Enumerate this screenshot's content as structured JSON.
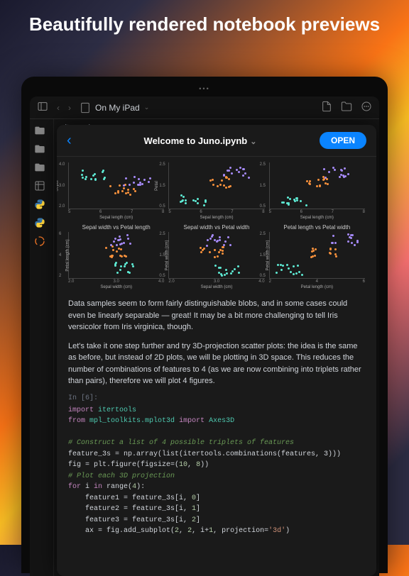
{
  "hero": {
    "title": "Beautifully rendered notebook previews"
  },
  "toolbar": {
    "breadcrumb": "On My iPad"
  },
  "sidebar": {
    "bg_label": "site-packages"
  },
  "modal": {
    "title": "Welcome to Juno.ipynb",
    "open_label": "OPEN"
  },
  "charts": {
    "row1": [
      {
        "title": "",
        "xlabel": "Sepal length (cm)",
        "ylabel": "Sepal",
        "xticks": [
          "5",
          "6",
          "7",
          "8"
        ],
        "yticks": [
          "2.0",
          "3.0",
          "4.0"
        ]
      },
      {
        "title": "",
        "xlabel": "Sepal length (cm)",
        "ylabel": "Petal",
        "xticks": [
          "5",
          "6",
          "7",
          "8"
        ],
        "yticks": [
          "0.5",
          "1.5",
          "2.5"
        ]
      },
      {
        "title": "",
        "xlabel": "Sepal length (cm)",
        "ylabel": "",
        "xticks": [
          "5",
          "6",
          "7",
          "8"
        ],
        "yticks": [
          "0.5",
          "1.5",
          "2.5"
        ]
      }
    ],
    "row2": [
      {
        "title": "Sepal width vs Petal length",
        "xlabel": "Sepal width (cm)",
        "ylabel": "Petal length (cm)",
        "xticks": [
          "2.0",
          "3.0",
          "4.0"
        ],
        "yticks": [
          "2",
          "4",
          "6"
        ]
      },
      {
        "title": "Sepal width vs Petal width",
        "xlabel": "Sepal width (cm)",
        "ylabel": "Petal width (cm)",
        "xticks": [
          "2.0",
          "3.0",
          "4.0"
        ],
        "yticks": [
          "0.5",
          "1.5",
          "2.5"
        ]
      },
      {
        "title": "Petal length vs Petal width",
        "xlabel": "Petal length (cm)",
        "ylabel": "Petal width (cm)",
        "xticks": [
          "2",
          "4",
          "6"
        ],
        "yticks": [
          "0.5",
          "1.5",
          "2.5"
        ]
      }
    ]
  },
  "prose": {
    "p1": "Data samples seem to form fairly distinguishable blobs, and in some cases could even be linearly separable — great! It may be a bit more challenging to tell Iris versicolor from Iris virginica, though.",
    "p2": "Let's take it one step further and try 3D-projection scatter plots: the idea is the same as before, but instead of 2D plots, we will be plotting in 3D space. This reduces the number of combinations of features to 4 (as we are now combining into triplets rather than pairs), therefore we will plot 4 figures."
  },
  "cell": {
    "prompt": "In [6]:",
    "code": {
      "l1_kw1": "import",
      "l1_mod": "itertools",
      "l2_kw1": "from",
      "l2_mod": "mpl_toolkits.mplot3d",
      "l2_kw2": "import",
      "l2_cls": "Axes3D",
      "l3_comment": "# Construct a list of 4 possible triplets of features",
      "l4": "feature_3s = np.array(list(itertools.combinations(features, 3)))",
      "l5a": "fig = plt.figure(figsize=(",
      "l5n1": "10",
      "l5b": ", ",
      "l5n2": "8",
      "l5c": "))",
      "l6_comment": "# Plot each 3D projection",
      "l7_kw": "for",
      "l7_rest": " i ",
      "l7_kw2": "in",
      "l7_rest2": " range(",
      "l7_n": "4",
      "l7_rest3": "):",
      "l8": "    feature1 = feature_3s[i, ",
      "l8n": "0",
      "l8b": "]",
      "l9": "    feature2 = feature_3s[i, ",
      "l9n": "1",
      "l9b": "]",
      "l10": "    feature3 = feature_3s[i, ",
      "l10n": "2",
      "l10b": "]",
      "l11a": "    ax = fig.add_subplot(",
      "l11n1": "2",
      "l11b": ", ",
      "l11n2": "2",
      "l11c": ", i+",
      "l11n3": "1",
      "l11d": ", projection=",
      "l11s": "'3d'",
      "l11e": ")"
    }
  }
}
